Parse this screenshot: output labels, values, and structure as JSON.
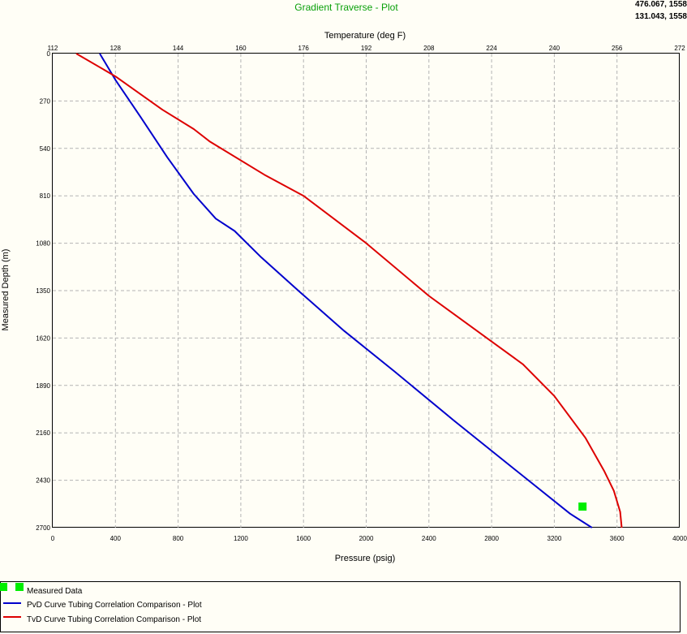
{
  "title": "Gradient Traverse - Plot",
  "readouts": [
    "476.067, 1558.0",
    "131.043, 1558.0"
  ],
  "chart_data": {
    "type": "line",
    "xlabel": "Pressure  (psig)",
    "x2label": "Temperature  (deg F)",
    "ylabel": "Measured Depth  (m)",
    "xlim": [
      0,
      4000
    ],
    "x2lim": [
      112,
      272
    ],
    "ylim": [
      0,
      2700
    ],
    "y_reversed": true,
    "grid": true,
    "legend_position": "bottom",
    "x_ticks": [
      "0",
      "400",
      "800",
      "1200",
      "1600",
      "2000",
      "2400",
      "2800",
      "3200",
      "3600",
      "4000"
    ],
    "x2_ticks": [
      "112",
      "128",
      "144",
      "160",
      "176",
      "192",
      "208",
      "224",
      "240",
      "256",
      "272"
    ],
    "y_ticks": [
      "0",
      "270",
      "540",
      "810",
      "1080",
      "1350",
      "1620",
      "1890",
      "2160",
      "2430",
      "2700"
    ],
    "series": [
      {
        "name": "PvD Curve Tubing Correlation Comparison - Plot",
        "color": "#0000cc",
        "x": [
          300,
          400,
          560,
          730,
          900,
          1040,
          1160,
          1330,
          1580,
          1860,
          2180,
          2560,
          2950,
          3300,
          3440
        ],
        "y": [
          0,
          150,
          360,
          590,
          800,
          940,
          1010,
          1160,
          1360,
          1580,
          1810,
          2090,
          2370,
          2620,
          2700
        ]
      },
      {
        "name": "TvD Curve Tubing Correlation Comparison - Plot",
        "color": "#dd0000",
        "x": [
          150,
          400,
          700,
          900,
          1000,
          1350,
          1600,
          2000,
          2400,
          2800,
          3000,
          3200,
          3400,
          3520,
          3580,
          3620,
          3630
        ],
        "y": [
          0,
          130,
          320,
          430,
          500,
          690,
          810,
          1080,
          1380,
          1640,
          1770,
          1950,
          2190,
          2380,
          2490,
          2610,
          2700
        ]
      }
    ],
    "measured_data": {
      "name": "Measured Data",
      "color": "#00ee00",
      "points": [
        {
          "x": 3380,
          "y": 2580
        }
      ]
    }
  }
}
